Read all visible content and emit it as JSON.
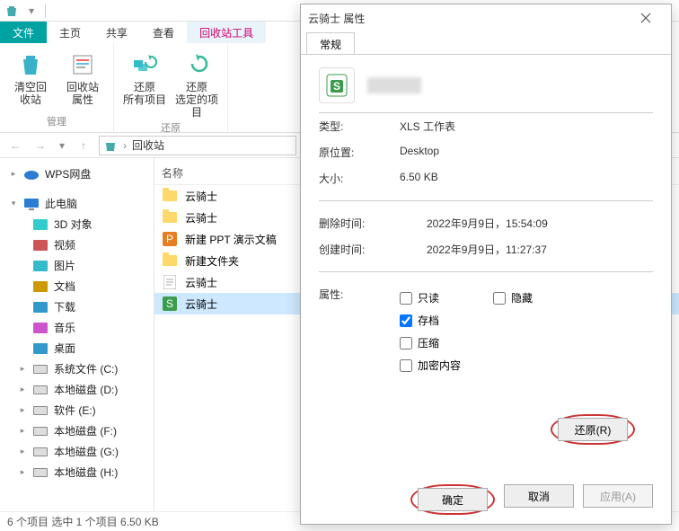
{
  "tabs": {
    "file": "文件",
    "home": "主页",
    "share": "共享",
    "view": "查看",
    "group": "管理",
    "tool": "回收站工具",
    "extra": "回收"
  },
  "ribbon": {
    "manage": {
      "empty": "清空回\n收站",
      "props": "回收站\n属性",
      "label": "管理"
    },
    "restore": {
      "all": "还原\n所有项目",
      "sel": "还原\n选定的项目",
      "label": "还原"
    }
  },
  "address": {
    "root": "回收站"
  },
  "nav": {
    "wps": "WPS网盘",
    "thispc": "此电脑",
    "items": [
      "3D 对象",
      "视频",
      "图片",
      "文档",
      "下载",
      "音乐",
      "桌面",
      "系统文件 (C:)",
      "本地磁盘 (D:)",
      "软件 (E:)",
      "本地磁盘 (F:)",
      "本地磁盘 (G:)",
      "本地磁盘 (H:)"
    ]
  },
  "list": {
    "header": "名称",
    "rows": [
      {
        "name": "云骑士",
        "type": "folder"
      },
      {
        "name": "云骑士",
        "type": "folder"
      },
      {
        "name": "新建 PPT 演示文稿",
        "type": "ppt"
      },
      {
        "name": "新建文件夹",
        "type": "folder"
      },
      {
        "name": "云骑士",
        "type": "txt"
      },
      {
        "name": "云骑士",
        "type": "xls"
      }
    ],
    "selected_index": 5
  },
  "status": "6 个项目    选中 1 个项目  6.50 KB",
  "dialog": {
    "title": "云骑士 属性",
    "tab": "常规",
    "type_k": "类型:",
    "type_v": "XLS 工作表",
    "loc_k": "原位置:",
    "loc_v": "Desktop",
    "size_k": "大小:",
    "size_v": "6.50 KB",
    "del_k": "删除时间:",
    "del_v": "2022年9月9日，15:54:09",
    "crt_k": "创建时间:",
    "crt_v": "2022年9月9日，11:27:37",
    "attr_k": "属性:",
    "readonly": "只读",
    "hidden": "隐藏",
    "archive": "存档",
    "compress": "压缩",
    "encrypt": "加密内容",
    "restore": "还原(R)",
    "ok": "确定",
    "cancel": "取消",
    "apply": "应用(A)"
  }
}
